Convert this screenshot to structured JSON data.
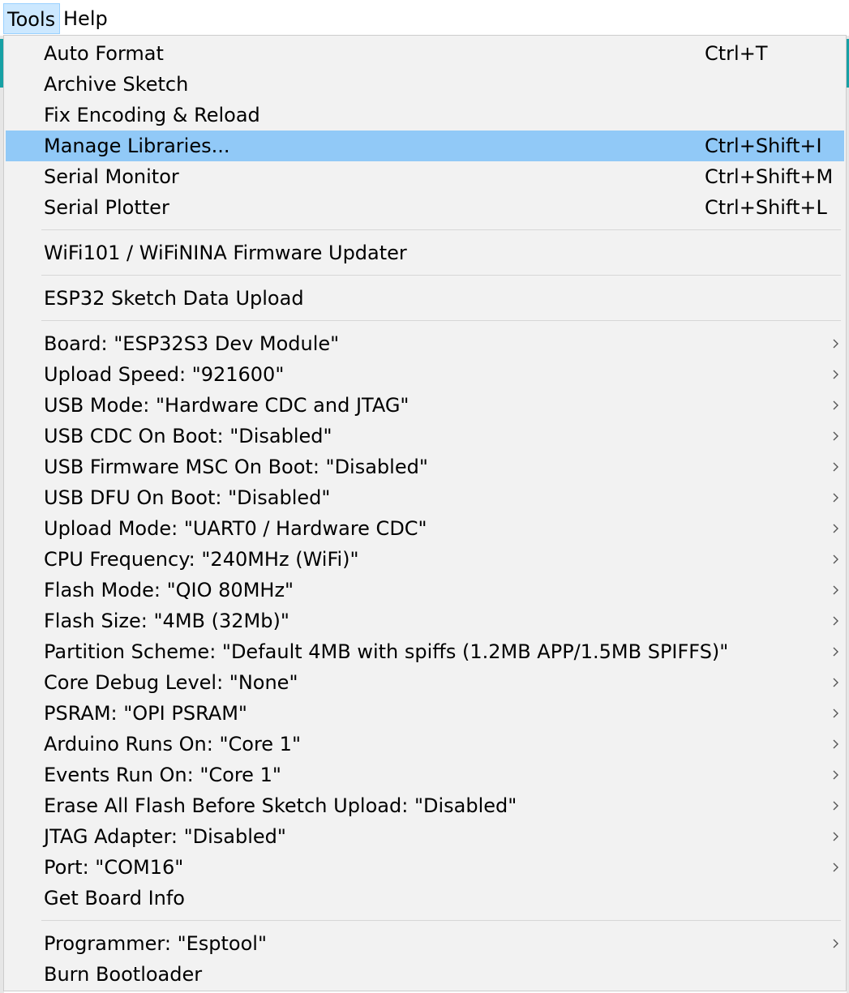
{
  "menubar": {
    "tools": "Tools",
    "help": "Help"
  },
  "menu": {
    "auto_format": {
      "label": "Auto Format",
      "shortcut": "Ctrl+T"
    },
    "archive_sketch": {
      "label": "Archive Sketch"
    },
    "fix_encoding": {
      "label": "Fix Encoding & Reload"
    },
    "manage_libraries": {
      "label": "Manage Libraries...",
      "shortcut": "Ctrl+Shift+I"
    },
    "serial_monitor": {
      "label": "Serial Monitor",
      "shortcut": "Ctrl+Shift+M"
    },
    "serial_plotter": {
      "label": "Serial Plotter",
      "shortcut": "Ctrl+Shift+L"
    },
    "firmware_updater": {
      "label": "WiFi101 / WiFiNINA Firmware Updater"
    },
    "esp32_data_upload": {
      "label": "ESP32 Sketch Data Upload"
    },
    "board": {
      "label": "Board: \"ESP32S3 Dev Module\""
    },
    "upload_speed": {
      "label": "Upload Speed: \"921600\""
    },
    "usb_mode": {
      "label": "USB Mode: \"Hardware CDC and JTAG\""
    },
    "usb_cdc": {
      "label": "USB CDC On Boot: \"Disabled\""
    },
    "usb_msc": {
      "label": "USB Firmware MSC On Boot: \"Disabled\""
    },
    "usb_dfu": {
      "label": "USB DFU On Boot: \"Disabled\""
    },
    "upload_mode": {
      "label": "Upload Mode: \"UART0 / Hardware CDC\""
    },
    "cpu_freq": {
      "label": "CPU Frequency: \"240MHz (WiFi)\""
    },
    "flash_mode": {
      "label": "Flash Mode: \"QIO 80MHz\""
    },
    "flash_size": {
      "label": "Flash Size: \"4MB (32Mb)\""
    },
    "partition": {
      "label": "Partition Scheme: \"Default 4MB with spiffs (1.2MB APP/1.5MB SPIFFS)\""
    },
    "debug_level": {
      "label": "Core Debug Level: \"None\""
    },
    "psram": {
      "label": "PSRAM: \"OPI PSRAM\""
    },
    "arduino_core": {
      "label": "Arduino Runs On: \"Core 1\""
    },
    "events_core": {
      "label": "Events Run On: \"Core 1\""
    },
    "erase_flash": {
      "label": "Erase All Flash Before Sketch Upload: \"Disabled\""
    },
    "jtag": {
      "label": "JTAG Adapter: \"Disabled\""
    },
    "port": {
      "label": "Port: \"COM16\""
    },
    "board_info": {
      "label": "Get Board Info"
    },
    "programmer": {
      "label": "Programmer: \"Esptool\""
    },
    "burn_bootloader": {
      "label": "Burn Bootloader"
    }
  },
  "icons": {
    "submenu": "chevron-right-icon"
  },
  "colors": {
    "highlight": "#91c9f7",
    "menubar_active": "#cce8ff",
    "menu_bg": "#f2f2f2"
  }
}
